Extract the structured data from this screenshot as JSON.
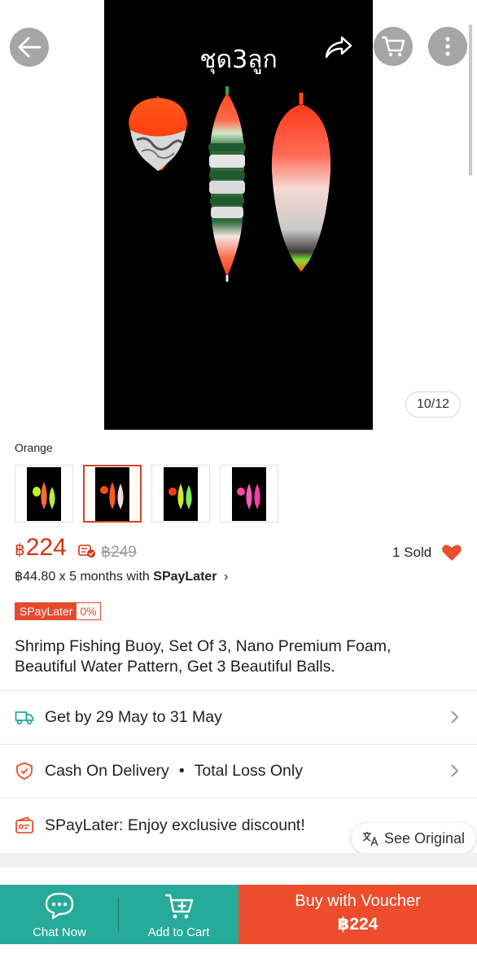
{
  "gallery": {
    "caption": "ชุด3ลูก",
    "counter": "10/12"
  },
  "icons": {
    "back": "back-arrow-icon",
    "share": "share-icon",
    "cart": "cart-icon",
    "more": "more-vertical-icon"
  },
  "variation": {
    "label": "Orange",
    "thumbnails": [
      {
        "name": "variation-thumbnail-1",
        "selected": false
      },
      {
        "name": "variation-thumbnail-2",
        "selected": true
      },
      {
        "name": "variation-thumbnail-3",
        "selected": false
      },
      {
        "name": "variation-thumbnail-4",
        "selected": false
      }
    ]
  },
  "price": {
    "currency": "฿",
    "current": "224",
    "original": "฿249",
    "sold": "1 Sold"
  },
  "installment": {
    "text": "฿44.80 x 5 months with ",
    "brand": "SPayLater",
    "chevron": "›"
  },
  "spaylater_badge": {
    "name": "SPayLater",
    "rate": "0%"
  },
  "product": {
    "title": "Shrimp Fishing Buoy, Set Of 3, Nano Premium Foam, Beautiful Water Pattern, Get 3 Beautiful Balls."
  },
  "rows": {
    "delivery": "Get by 29 May to 31 May",
    "cod": "Cash On Delivery",
    "cod_dot": "•",
    "cod_extra": "Total Loss Only",
    "promo": "SPayLater: Enjoy exclusive discount!"
  },
  "see_original": "See Original",
  "bottom_bar": {
    "chat": "Chat Now",
    "cart": "Add to Cart",
    "buy_line1": "Buy with Voucher",
    "buy_line2": "฿224"
  },
  "colors": {
    "accent": "#ee4d2d",
    "price": "#d73211",
    "teal": "#26aa99",
    "heart": "#ee4d2d"
  }
}
